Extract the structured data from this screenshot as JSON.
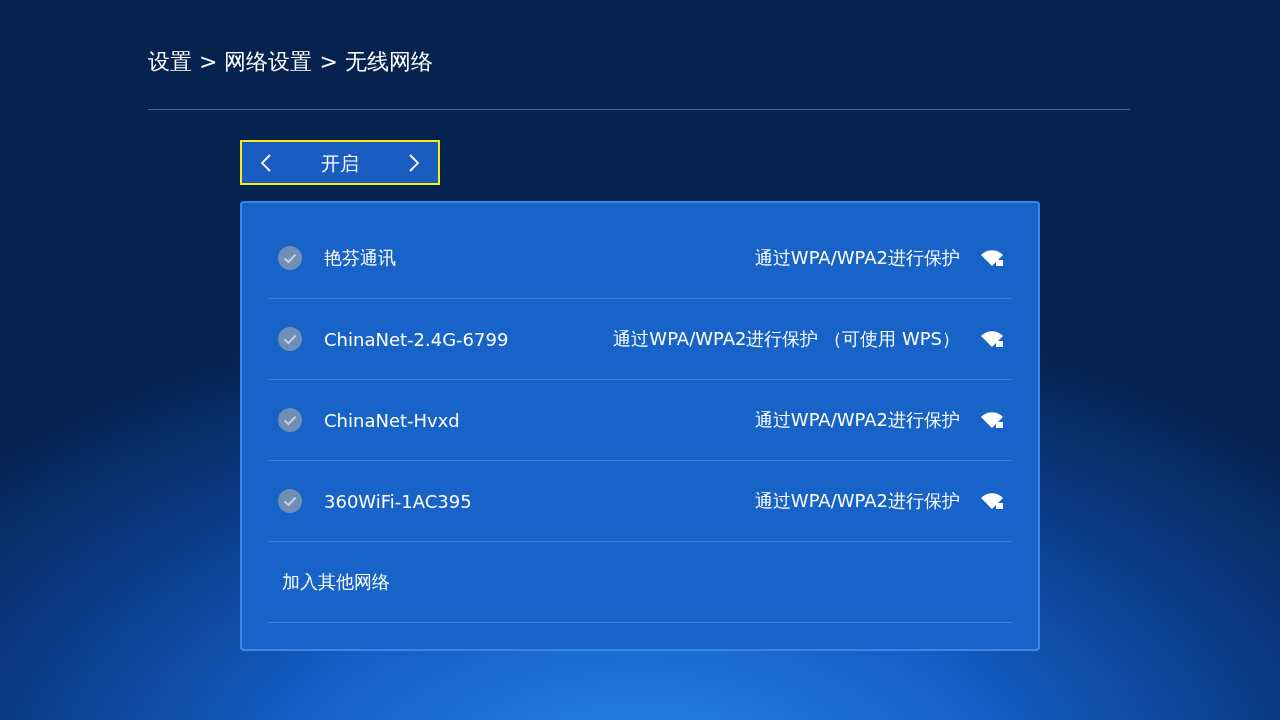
{
  "breadcrumb": "设置 > 网络设置 > 无线网络",
  "toggle": {
    "value": "开启",
    "focused": true
  },
  "networks": [
    {
      "name": "艳芬通讯",
      "security": "通过WPA/WPA2进行保护",
      "connected": false
    },
    {
      "name": "ChinaNet-2.4G-6799",
      "security": "通过WPA/WPA2进行保护 （可使用 WPS）",
      "connected": false
    },
    {
      "name": "ChinaNet-Hvxd",
      "security": "通过WPA/WPA2进行保护",
      "connected": false
    },
    {
      "name": "360WiFi-1AC395",
      "security": "通过WPA/WPA2进行保护",
      "connected": false
    }
  ],
  "other_network": "加入其他网络"
}
